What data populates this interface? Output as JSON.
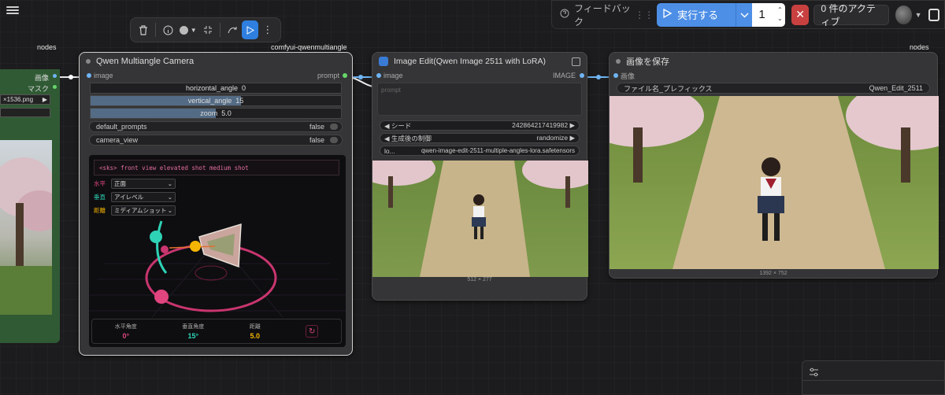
{
  "toolbar": {
    "feedback_label": "フィードバック",
    "run_label": "実行する",
    "run_count": "1",
    "active_label": "0 件のアクティブ"
  },
  "groups": {
    "left_group_label": "nodes",
    "camera_group_label": "comfyui-qwenmultiangle",
    "right_group_label": "nodes"
  },
  "left_node": {
    "output_image": "画像",
    "output_mask": "マスク",
    "file_label": "×1536.png"
  },
  "camera_node": {
    "title": "Qwen Multiangle Camera",
    "input_image": "image",
    "output_prompt": "prompt",
    "horizontal_angle": {
      "label": "horizontal_angle",
      "value": "0",
      "fraction": 0.0
    },
    "vertical_angle": {
      "label": "vertical_angle",
      "value": "15",
      "fraction": 0.6
    },
    "zoom": {
      "label": "zoom",
      "value": "5.0",
      "fraction": 0.5
    },
    "default_prompts": {
      "label": "default_prompts",
      "value": "false"
    },
    "camera_view": {
      "label": "camera_view",
      "value": "false"
    },
    "prompt_preview": "<sks> front view elevated shot medium shot",
    "horizontal_label": "水平",
    "horizontal_option": "正面",
    "vertical_label": "垂直",
    "vertical_option": "アイレベル",
    "distance_label": "距離",
    "distance_option": "ミディアムショット",
    "stat_horizontal_label": "水平角度",
    "stat_horizontal_value": "0°",
    "stat_vertical_label": "垂直角度",
    "stat_vertical_value": "15°",
    "stat_distance_label": "距離",
    "stat_distance_value": "5.0"
  },
  "edit_node": {
    "title": "Image Edit(Qwen Image 2511 with LoRA)",
    "input_image": "image",
    "output_image": "IMAGE",
    "prompt_placeholder": "prompt",
    "seed_label": "シード",
    "seed_value": "242864217419982",
    "control_label": "生成後の制御",
    "control_value": "randomize",
    "lora_label": "lo...",
    "lora_value": "qwen-image-edit-2511-multiple-angles-lora.safetensors",
    "image_size": "512 × 277"
  },
  "save_node": {
    "title": "画像を保存",
    "input_image": "画像",
    "prefix_label": "ファイル名_プレフィックス",
    "prefix_value": "Qwen_Edit_2511",
    "image_size": "1392 × 752"
  },
  "colors": {
    "accent_blue": "#4d8fe6",
    "cancel_red": "#c84040",
    "pink": "#e0457f",
    "teal": "#2ed3b5",
    "yellow": "#f5b400"
  },
  "icons": [
    "menu-icon",
    "trash-icon",
    "info-icon",
    "color-icon",
    "collapse-icon",
    "bypass-icon",
    "run-icon",
    "more-icon",
    "help-icon",
    "play-icon",
    "chevron-down-icon",
    "close-icon",
    "expand-icon",
    "reset-icon",
    "settings-icon"
  ]
}
